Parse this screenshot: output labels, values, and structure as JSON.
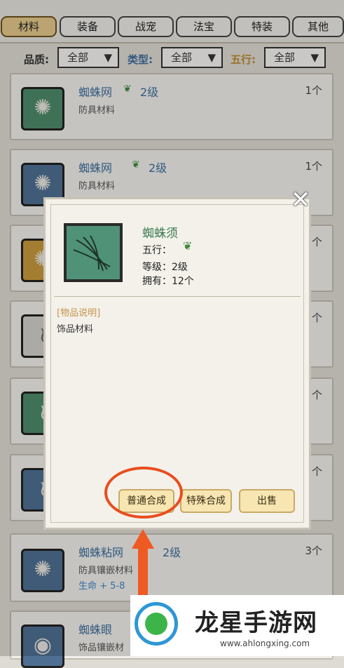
{
  "tabs": [
    "材料",
    "装备",
    "战宠",
    "法宝",
    "特装",
    "其他"
  ],
  "filters": {
    "quality_label": "品质:",
    "quality_value": "全部",
    "type_label": "类型:",
    "type_value": "全部",
    "element_label": "五行:",
    "element_value": "全部"
  },
  "list": [
    {
      "name": "蜘蛛网",
      "level": "2级",
      "desc": "防具材料",
      "count": "1个"
    },
    {
      "name": "蜘蛛网",
      "level": "2级",
      "desc": "防具材料",
      "count": "1个"
    },
    {
      "name": "",
      "level": "",
      "desc": "",
      "count": "1个"
    },
    {
      "name": "",
      "level": "",
      "desc": "",
      "count": "35个"
    },
    {
      "name": "",
      "level": "",
      "desc": "",
      "count": "12个"
    },
    {
      "name": "",
      "level": "",
      "desc": "",
      "count": "1个"
    },
    {
      "name": "蜘蛛粘网",
      "level": "2级",
      "desc": "防具镶嵌材料",
      "bonus": "生命 + 5-8",
      "count": "3个"
    },
    {
      "name": "蜘蛛眼",
      "level": "",
      "desc": "饰品镶嵌材",
      "count": ""
    }
  ],
  "modal": {
    "name": "蜘蛛须",
    "element_label": "五行：",
    "level_label": "等级：2级",
    "owned_label": "拥有：12个",
    "desc_header": "[物品说明]",
    "desc_body": "饰品材料",
    "buttons": [
      "普通合成",
      "特殊合成",
      "出售"
    ]
  },
  "watermark": {
    "title": "龙星手游网",
    "url": "www.ahlongxing.com"
  }
}
